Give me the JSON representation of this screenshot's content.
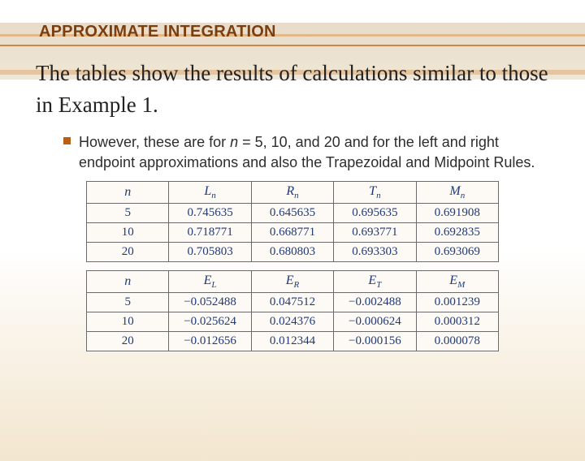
{
  "title": "APPROXIMATE INTEGRATION",
  "lead": "The tables show the results of calculations similar to those in Example 1.",
  "bullet": {
    "prefix": "However, these are for ",
    "var": "n",
    "mid": " = 5, 10, and 20 and for the left and right endpoint approximations and also the Trapezoidal and Midpoint Rules."
  },
  "chart_data": [
    {
      "type": "table",
      "title": "Approximation values",
      "columns": [
        "n",
        "L_n",
        "R_n",
        "T_n",
        "M_n"
      ],
      "rows": [
        [
          "5",
          "0.745635",
          "0.645635",
          "0.695635",
          "0.691908"
        ],
        [
          "10",
          "0.718771",
          "0.668771",
          "0.693771",
          "0.692835"
        ],
        [
          "20",
          "0.705803",
          "0.680803",
          "0.693303",
          "0.693069"
        ]
      ]
    },
    {
      "type": "table",
      "title": "Error values",
      "columns": [
        "n",
        "E_L",
        "E_R",
        "E_T",
        "E_M"
      ],
      "rows": [
        [
          "5",
          "−0.052488",
          "0.047512",
          "−0.002488",
          "0.001239"
        ],
        [
          "10",
          "−0.025624",
          "0.024376",
          "−0.000624",
          "0.000312"
        ],
        [
          "20",
          "−0.012656",
          "0.012344",
          "−0.000156",
          "0.000078"
        ]
      ]
    }
  ]
}
